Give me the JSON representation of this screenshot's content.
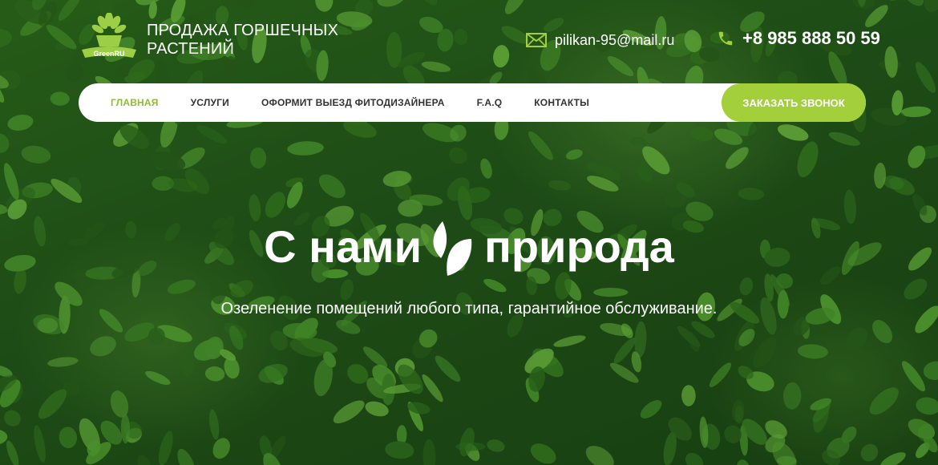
{
  "brand": {
    "logo_text": "GreenRU",
    "title_line1": "ПРОДАЖА ГОРШЕЧНЫХ",
    "title_line2": "РАСТЕНИЙ"
  },
  "contacts": {
    "email": "pilikan-95@mail.ru",
    "phone": "+8 985 888 50 59"
  },
  "nav": {
    "items": [
      {
        "label": "ГЛАВНАЯ"
      },
      {
        "label": "УСЛУГИ"
      },
      {
        "label": "ОФОРМИТ ВЫЕЗД ФИТОДИЗАЙНЕРА"
      },
      {
        "label": "F.A.Q"
      },
      {
        "label": "КОНТАКТЫ"
      }
    ],
    "cta_label": "ЗАКАЗАТЬ ЗВОНОК"
  },
  "hero": {
    "title_left": "С нами",
    "title_right": "природа",
    "subtitle": "Озеленение помещений любого типа, гарантийное обслуживание."
  },
  "colors": {
    "accent": "#a2cf3a",
    "active_nav": "#8cbf2e",
    "background": "#2a5e1c"
  }
}
